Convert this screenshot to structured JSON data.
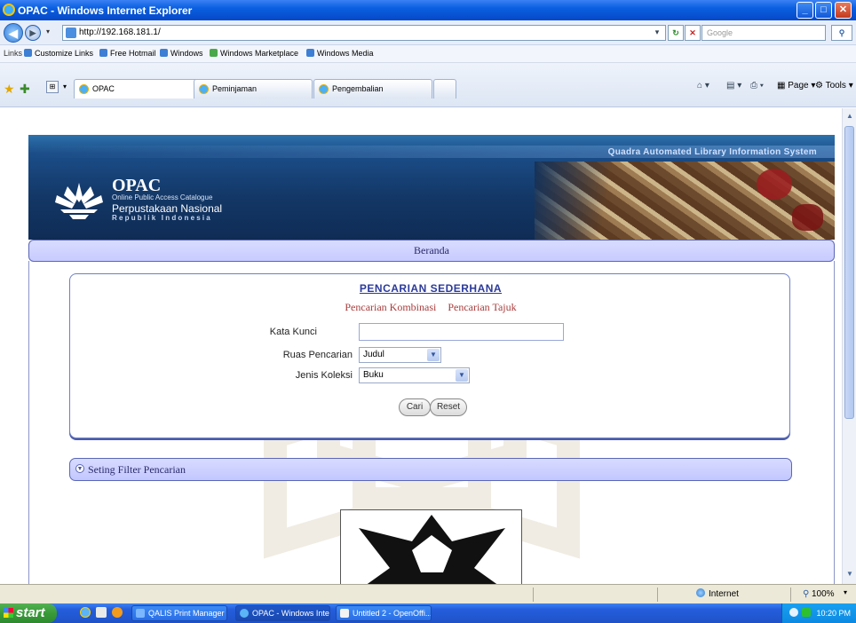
{
  "window": {
    "title": "OPAC - Windows Internet Explorer",
    "buttons": {
      "minimize": "_",
      "maximize": "□",
      "close": "✕"
    }
  },
  "address_bar": {
    "back": "◀",
    "forward": "▶",
    "url": "http://192.168.181.1/",
    "search_placeholder": "Google",
    "refresh": "↻",
    "stop": "✕"
  },
  "links_bar": {
    "label": "Links",
    "items": [
      "Customize Links",
      "Free Hotmail",
      "Windows",
      "Windows Marketplace",
      "Windows Media"
    ]
  },
  "tabs": [
    {
      "label": "OPAC",
      "active": true
    },
    {
      "label": "Peminjaman",
      "active": false
    },
    {
      "label": "Pengembalian",
      "active": false
    }
  ],
  "toolbar": {
    "page_label": "Page",
    "tools_label": "Tools"
  },
  "banner": {
    "system_name": "Quadra Automated Library Information System",
    "opac_title": "OPAC",
    "opac_subtitle": "Online Public Access Catalogue",
    "library_name": "Perpustakaan Nasional",
    "country": "Republik Indonesia"
  },
  "nav": {
    "beranda": "Beranda"
  },
  "search": {
    "title": "PENCARIAN SEDERHANA",
    "links": [
      "Pencarian Kombinasi",
      "Pencarian Tajuk"
    ],
    "keyword_label": "Kata Kunci",
    "keyword_value": "",
    "field_label": "Ruas Pencarian",
    "field_value": "Judul",
    "collection_label": "Jenis Koleksi",
    "collection_value": "Buku",
    "search_button": "Cari",
    "reset_button": "Reset"
  },
  "filter": {
    "label": "Seting Filter Pencarian"
  },
  "status_bar": {
    "zone": "Internet",
    "zoom": "100%"
  },
  "taskbar": {
    "start": "start",
    "tasks": [
      "QALIS Print Manager",
      "OPAC - Windows Inte...",
      "Untitled 2 - OpenOffi..."
    ],
    "clock": "10:20 PM"
  }
}
